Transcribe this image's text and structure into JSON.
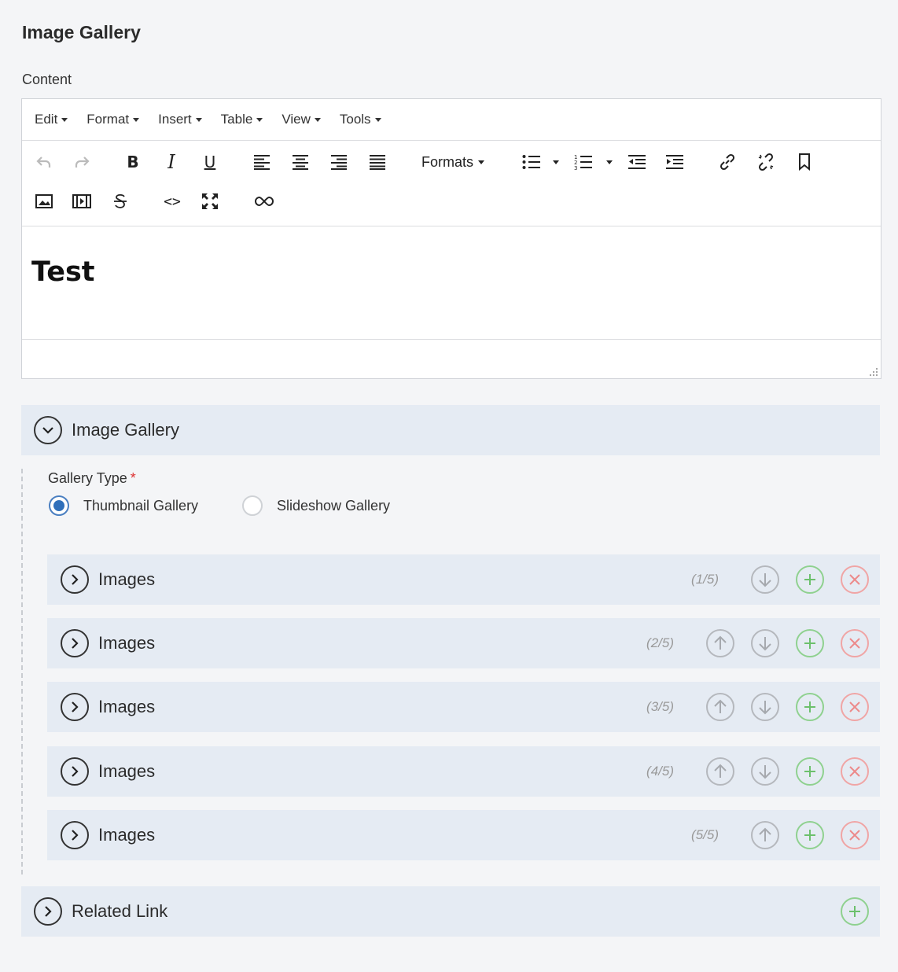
{
  "page": {
    "title": "Image Gallery"
  },
  "content_field": {
    "label": "Content"
  },
  "editor": {
    "menus": [
      "Edit",
      "Format",
      "Insert",
      "Table",
      "View",
      "Tools"
    ],
    "formats_label": "Formats",
    "body_heading": "Test"
  },
  "gallery_section": {
    "title": "Image Gallery"
  },
  "gallery_type": {
    "label": "Gallery Type",
    "required_mark": "*",
    "options": [
      {
        "label": "Thumbnail Gallery",
        "selected": true
      },
      {
        "label": "Slideshow Gallery",
        "selected": false
      }
    ]
  },
  "images": [
    {
      "title": "Images",
      "counter": "(1/5)",
      "can_move_up": false,
      "can_move_down": true
    },
    {
      "title": "Images",
      "counter": "(2/5)",
      "can_move_up": true,
      "can_move_down": true
    },
    {
      "title": "Images",
      "counter": "(3/5)",
      "can_move_up": true,
      "can_move_down": true
    },
    {
      "title": "Images",
      "counter": "(4/5)",
      "can_move_up": true,
      "can_move_down": true
    },
    {
      "title": "Images",
      "counter": "(5/5)",
      "can_move_up": true,
      "can_move_down": false
    }
  ],
  "related_link": {
    "title": "Related Link"
  },
  "colors": {
    "panel_bg": "#e5ebf3",
    "radio_selected": "#2f6fba",
    "add": "#6cc06c",
    "remove": "#ec8a8a",
    "required": "#dd3333"
  }
}
